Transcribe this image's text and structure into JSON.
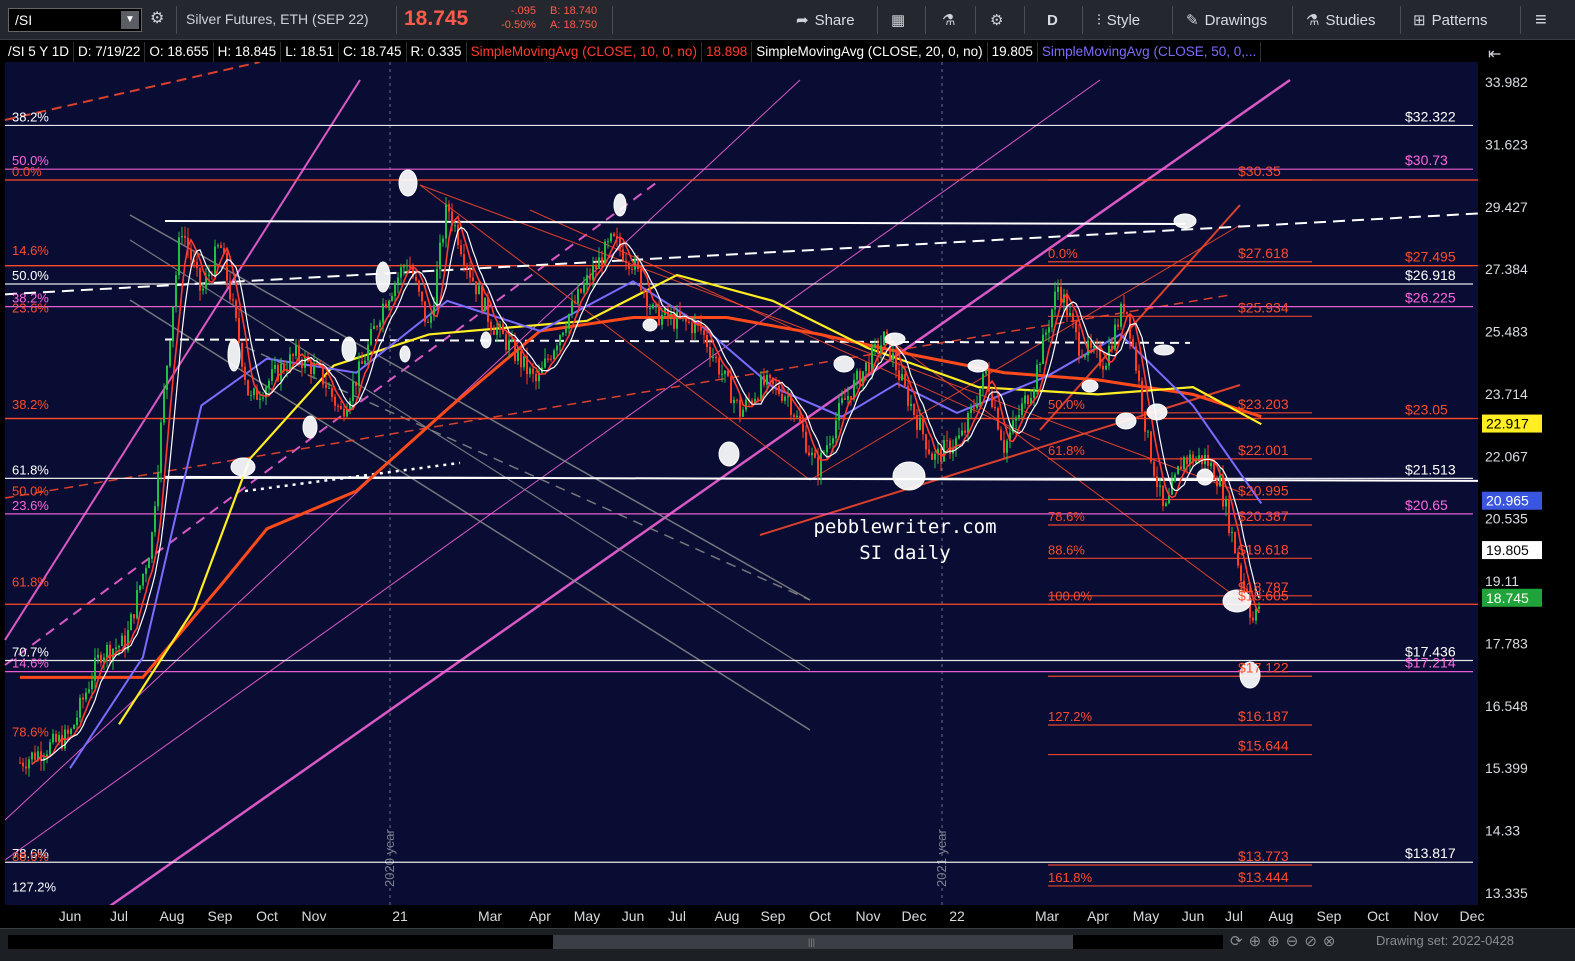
{
  "toolbar": {
    "symbol": "/SI",
    "description": "Silver Futures, ETH (SEP 22)",
    "last": "18.745",
    "change": "-.095",
    "change_pct": "-0.50%",
    "bid": "B: 18.740",
    "ask": "A: 18.750",
    "share": "Share",
    "period": "D",
    "style": "Style",
    "drawings": "Drawings",
    "studies": "Studies",
    "patterns": "Patterns"
  },
  "info": {
    "header": "/SI 5 Y 1D",
    "date": "D: 7/19/22",
    "open": "O: 18.655",
    "high": "H: 18.845",
    "low": "L: 18.51",
    "close": "C: 18.745",
    "range": "R: 0.335",
    "sma10_label": "SimpleMovingAvg (CLOSE, 10, 0, no)",
    "sma10_value": "18.898",
    "sma20_label": "SimpleMovingAvg (CLOSE, 20, 0, no)",
    "sma20_value": "19.805",
    "sma50_label": "SimpleMovingAvg (CLOSE, 50, 0,..."
  },
  "colors": {
    "background": "#0a0d33",
    "sma10": "#ff3b30",
    "sma20": "#ffffff",
    "sma50": "#7b6cff",
    "sma100": "#ffee22",
    "sma200": "#ff4a1c",
    "fib_red": "#ff4a2a",
    "magenta": "#ff66e0",
    "price_red": "#ff5a4a"
  },
  "watermark": [
    "pebblewriter.com",
    "SI daily"
  ],
  "year_markers": [
    "2020 year",
    "2021 year"
  ],
  "footer": {
    "drawing_set": "Drawing set: 2022-0428"
  },
  "chart_data": {
    "type": "candlestick",
    "title": "/SI 5 Y 1D",
    "ylim": [
      13.0,
      35.0
    ],
    "y_scale": "log",
    "ticks_y": [
      "33.982",
      "31.623",
      "29.427",
      "27.384",
      "25.483",
      "23.714",
      "22.067",
      "20.535",
      "19.11",
      "17.783",
      "16.548",
      "15.399",
      "14.33",
      "13.335"
    ],
    "x_months": [
      {
        "label": "Jun",
        "date": "2020-06-01"
      },
      {
        "label": "Jul",
        "date": "2020-07-01"
      },
      {
        "label": "Aug",
        "date": "2020-08-01"
      },
      {
        "label": "Sep",
        "date": "2020-09-01"
      },
      {
        "label": "Oct",
        "date": "2020-10-01"
      },
      {
        "label": "Nov",
        "date": "2020-11-01"
      },
      {
        "label": "21",
        "date": "2021-01-01"
      },
      {
        "label": "Mar",
        "date": "2021-03-01"
      },
      {
        "label": "Apr",
        "date": "2021-04-01"
      },
      {
        "label": "May",
        "date": "2021-05-01"
      },
      {
        "label": "Jun",
        "date": "2021-06-01"
      },
      {
        "label": "Jul",
        "date": "2021-07-01"
      },
      {
        "label": "Aug",
        "date": "2021-08-01"
      },
      {
        "label": "Sep",
        "date": "2021-09-01"
      },
      {
        "label": "Oct",
        "date": "2021-10-01"
      },
      {
        "label": "Nov",
        "date": "2021-11-01"
      },
      {
        "label": "Dec",
        "date": "2021-12-01"
      },
      {
        "label": "22",
        "date": "2022-01-01"
      },
      {
        "label": "Mar",
        "date": "2022-03-01"
      },
      {
        "label": "Apr",
        "date": "2022-04-01"
      },
      {
        "label": "May",
        "date": "2022-05-01"
      },
      {
        "label": "Jun",
        "date": "2022-06-01"
      },
      {
        "label": "Jul",
        "date": "2022-07-01"
      },
      {
        "label": "Aug",
        "date": "2022-08-01"
      },
      {
        "label": "Sep",
        "date": "2022-09-01"
      },
      {
        "label": "Oct",
        "date": "2022-10-01"
      },
      {
        "label": "Nov",
        "date": "2022-11-01"
      },
      {
        "label": "Dec",
        "date": "2022-12-01"
      }
    ],
    "price_path": [
      [
        "2020-05-15",
        15.5
      ],
      [
        "2020-06-01",
        16.0
      ],
      [
        "2020-06-20",
        17.6
      ],
      [
        "2020-07-05",
        17.8
      ],
      [
        "2020-07-20",
        20.0
      ],
      [
        "2020-08-07",
        28.8
      ],
      [
        "2020-08-20",
        26.6
      ],
      [
        "2020-09-01",
        28.2
      ],
      [
        "2020-09-20",
        23.5
      ],
      [
        "2020-10-05",
        24.2
      ],
      [
        "2020-10-20",
        24.8
      ],
      [
        "2020-11-05",
        24.3
      ],
      [
        "2020-11-20",
        23.2
      ],
      [
        "2020-12-05",
        24.5
      ],
      [
        "2020-12-20",
        26.3
      ],
      [
        "2021-01-06",
        27.7
      ],
      [
        "2021-01-20",
        25.5
      ],
      [
        "2021-02-01",
        29.5
      ],
      [
        "2021-02-15",
        27.4
      ],
      [
        "2021-03-01",
        25.8
      ],
      [
        "2021-03-30",
        24.0
      ],
      [
        "2021-04-15",
        25.6
      ],
      [
        "2021-05-01",
        27.0
      ],
      [
        "2021-05-18",
        28.3
      ],
      [
        "2021-06-01",
        27.6
      ],
      [
        "2021-06-15",
        26.0
      ],
      [
        "2021-07-01",
        25.8
      ],
      [
        "2021-07-15",
        25.6
      ],
      [
        "2021-08-10",
        23.2
      ],
      [
        "2021-08-25",
        24.0
      ],
      [
        "2021-09-10",
        23.7
      ],
      [
        "2021-09-29",
        21.7
      ],
      [
        "2021-10-15",
        23.4
      ],
      [
        "2021-11-12",
        25.3
      ],
      [
        "2021-11-25",
        23.8
      ],
      [
        "2021-12-15",
        22.0
      ],
      [
        "2022-01-05",
        22.6
      ],
      [
        "2022-01-20",
        24.3
      ],
      [
        "2022-02-01",
        22.3
      ],
      [
        "2022-02-20",
        24.0
      ],
      [
        "2022-03-08",
        26.9
      ],
      [
        "2022-03-20",
        25.1
      ],
      [
        "2022-04-05",
        24.6
      ],
      [
        "2022-04-18",
        26.4
      ],
      [
        "2022-05-02",
        22.5
      ],
      [
        "2022-05-13",
        20.6
      ],
      [
        "2022-05-25",
        22.0
      ],
      [
        "2022-06-10",
        22.0
      ],
      [
        "2022-06-20",
        21.5
      ],
      [
        "2022-07-05",
        19.3
      ],
      [
        "2022-07-14",
        18.2
      ],
      [
        "2022-07-19",
        18.745
      ]
    ],
    "series": [
      {
        "name": "SimpleMovingAvg (CLOSE, 10, 0, no)",
        "color": "#ff3b30",
        "last": 18.898
      },
      {
        "name": "SimpleMovingAvg (CLOSE, 20, 0, no)",
        "color": "#ffffff",
        "last": 19.805
      },
      {
        "name": "SimpleMovingAvg (CLOSE, 50, 0,...",
        "color": "#7b6cff",
        "last": 20.965
      }
    ],
    "sma100_path": [
      [
        "2020-07-01",
        16.2
      ],
      [
        "2020-08-15",
        18.5
      ],
      [
        "2020-09-20",
        22.0
      ],
      [
        "2020-11-15",
        24.5
      ],
      [
        "2021-01-20",
        25.4
      ],
      [
        "2021-05-01",
        25.8
      ],
      [
        "2021-07-01",
        27.2
      ],
      [
        "2021-09-01",
        26.4
      ],
      [
        "2021-11-01",
        25.0
      ],
      [
        "2022-01-15",
        23.9
      ],
      [
        "2022-04-01",
        23.7
      ],
      [
        "2022-06-01",
        23.9
      ],
      [
        "2022-07-19",
        22.9
      ]
    ],
    "sma200_path": [
      [
        "2020-05-15",
        17.1
      ],
      [
        "2020-07-15",
        17.1
      ],
      [
        "2020-09-01",
        19.0
      ],
      [
        "2020-10-01",
        20.3
      ],
      [
        "2020-12-01",
        21.2
      ],
      [
        "2021-02-01",
        23.3
      ],
      [
        "2021-04-01",
        25.5
      ],
      [
        "2021-06-01",
        25.9
      ],
      [
        "2021-08-01",
        25.9
      ],
      [
        "2021-10-01",
        25.4
      ],
      [
        "2021-12-01",
        24.8
      ],
      [
        "2022-02-01",
        24.3
      ],
      [
        "2022-04-01",
        24.1
      ],
      [
        "2022-06-01",
        23.7
      ],
      [
        "2022-07-19",
        23.1
      ]
    ],
    "sma50_path": [
      [
        "2020-06-01",
        15.4
      ],
      [
        "2020-07-15",
        17.5
      ],
      [
        "2020-08-20",
        23.4
      ],
      [
        "2020-10-01",
        24.7
      ],
      [
        "2020-12-01",
        24.3
      ],
      [
        "2021-02-01",
        26.4
      ],
      [
        "2021-04-01",
        25.5
      ],
      [
        "2021-06-01",
        27.0
      ],
      [
        "2021-07-15",
        25.7
      ],
      [
        "2021-09-01",
        23.9
      ],
      [
        "2021-10-15",
        23.1
      ],
      [
        "2021-11-20",
        24.0
      ],
      [
        "2022-01-01",
        23.2
      ],
      [
        "2022-03-01",
        24.2
      ],
      [
        "2022-04-15",
        25.4
      ],
      [
        "2022-06-01",
        23.4
      ],
      [
        "2022-07-19",
        20.9
      ]
    ],
    "right_labels": [
      {
        "text": "$32.322",
        "value": 32.322,
        "color": "#ffffff"
      },
      {
        "text": "$30.73",
        "value": 30.73,
        "color": "#ff66e0"
      },
      {
        "text": "$30.35",
        "value": 30.35,
        "color": "#ff4a2a",
        "col": "mid"
      },
      {
        "text": "$27.618",
        "value": 27.618,
        "color": "#ff4a2a",
        "col": "mid"
      },
      {
        "text": "$27.495",
        "value": 27.495,
        "color": "#ff4a2a"
      },
      {
        "text": "$26.918",
        "value": 26.918,
        "color": "#ffffff"
      },
      {
        "text": "$26.225",
        "value": 26.225,
        "color": "#ff66e0"
      },
      {
        "text": "$25.934",
        "value": 25.934,
        "color": "#ff4a2a",
        "col": "mid"
      },
      {
        "text": "$23.203",
        "value": 23.203,
        "color": "#ff4a2a",
        "col": "mid"
      },
      {
        "text": "$23.05",
        "value": 23.05,
        "color": "#ff4a2a"
      },
      {
        "text": "$22.001",
        "value": 22.001,
        "color": "#ff4a2a",
        "col": "mid"
      },
      {
        "text": "$21.513",
        "value": 21.513,
        "color": "#ffffff"
      },
      {
        "text": "$20.995",
        "value": 20.995,
        "color": "#ff4a2a",
        "col": "mid"
      },
      {
        "text": "$20.65",
        "value": 20.65,
        "color": "#ff66e0"
      },
      {
        "text": "$20.387",
        "value": 20.387,
        "color": "#ff4a2a",
        "col": "mid"
      },
      {
        "text": "$19.618",
        "value": 19.618,
        "color": "#ff4a2a",
        "col": "mid"
      },
      {
        "text": "$18.787",
        "value": 18.787,
        "color": "#ff4a2a",
        "col": "left"
      },
      {
        "text": "$18.605",
        "value": 18.605,
        "color": "#ff4a2a",
        "col": "mid"
      },
      {
        "text": "$17.436",
        "value": 17.436,
        "color": "#ffffff"
      },
      {
        "text": "$17.214",
        "value": 17.214,
        "color": "#ff66e0"
      },
      {
        "text": "$17.122",
        "value": 17.122,
        "color": "#ff4a2a",
        "col": "left"
      },
      {
        "text": "$16.187",
        "value": 16.187,
        "color": "#ff4a2a",
        "col": "mid"
      },
      {
        "text": "$15.644",
        "value": 15.644,
        "color": "#ff4a2a",
        "col": "mid"
      },
      {
        "text": "$13.817",
        "value": 13.817,
        "color": "#ffffff"
      },
      {
        "text": "$13.773",
        "value": 13.773,
        "color": "#ff4a2a",
        "col": "mid"
      },
      {
        "text": "$13.444",
        "value": 13.444,
        "color": "#ff4a2a",
        "col": "mid"
      }
    ],
    "left_fib_labels": [
      {
        "text": "38.2%",
        "value": 32.322,
        "color": "#ffffff"
      },
      {
        "text": "50.0%",
        "value": 30.73,
        "color": "#ff66e0"
      },
      {
        "text": "0.0%",
        "value": 30.35,
        "color": "#ff4a2a"
      },
      {
        "text": "14.6%",
        "value": 27.7,
        "color": "#ff4a2a"
      },
      {
        "text": "50.0%",
        "value": 26.918,
        "color": "#ffffff"
      },
      {
        "text": "38.2%",
        "value": 26.225,
        "color": "#ff66e0"
      },
      {
        "text": "23.6%",
        "value": 25.934,
        "color": "#ff4a2a"
      },
      {
        "text": "38.2%",
        "value": 23.2,
        "color": "#ff4a2a"
      },
      {
        "text": "61.8%",
        "value": 21.513,
        "color": "#ffffff"
      },
      {
        "text": "50.0%",
        "value": 20.995,
        "color": "#ff4a2a"
      },
      {
        "text": "23.6%",
        "value": 20.65,
        "color": "#ff66e0"
      },
      {
        "text": "61.8%",
        "value": 18.9,
        "color": "#ff4a2a"
      },
      {
        "text": "70.7%",
        "value": 17.436,
        "color": "#ffffff"
      },
      {
        "text": "14.6%",
        "value": 17.214,
        "color": "#ff66e0"
      },
      {
        "text": "78.6%",
        "value": 15.9,
        "color": "#ff4a2a"
      },
      {
        "text": "78.6%",
        "value": 13.817,
        "color": "#ffffff"
      },
      {
        "text": "88.6%",
        "value": 13.773,
        "color": "#ff4a2a"
      },
      {
        "text": "127.2%",
        "value": 13.3,
        "color": "#ffffff"
      }
    ],
    "mid_fib_labels": [
      {
        "text": "0.0%",
        "value": 27.618
      },
      {
        "text": "50.0%",
        "value": 23.203
      },
      {
        "text": "61.8%",
        "value": 22.001
      },
      {
        "text": "78.6%",
        "value": 20.387
      },
      {
        "text": "88.6%",
        "value": 19.618
      },
      {
        "text": "100.0%",
        "value": 18.605
      },
      {
        "text": "127.2%",
        "value": 16.187
      },
      {
        "text": "161.8%",
        "value": 13.444
      }
    ],
    "axis_badges": [
      {
        "text": "22.917",
        "value": 22.917,
        "bg": "#ffee22",
        "fg": "#000000"
      },
      {
        "text": "20.965",
        "value": 20.965,
        "bg": "#3a55e0",
        "fg": "#ffffff"
      },
      {
        "text": "19.805",
        "value": 19.805,
        "bg": "#ffffff",
        "fg": "#000000"
      },
      {
        "text": "18.745",
        "value": 18.745,
        "bg": "#1fa33a",
        "fg": "#ffffff"
      }
    ]
  }
}
